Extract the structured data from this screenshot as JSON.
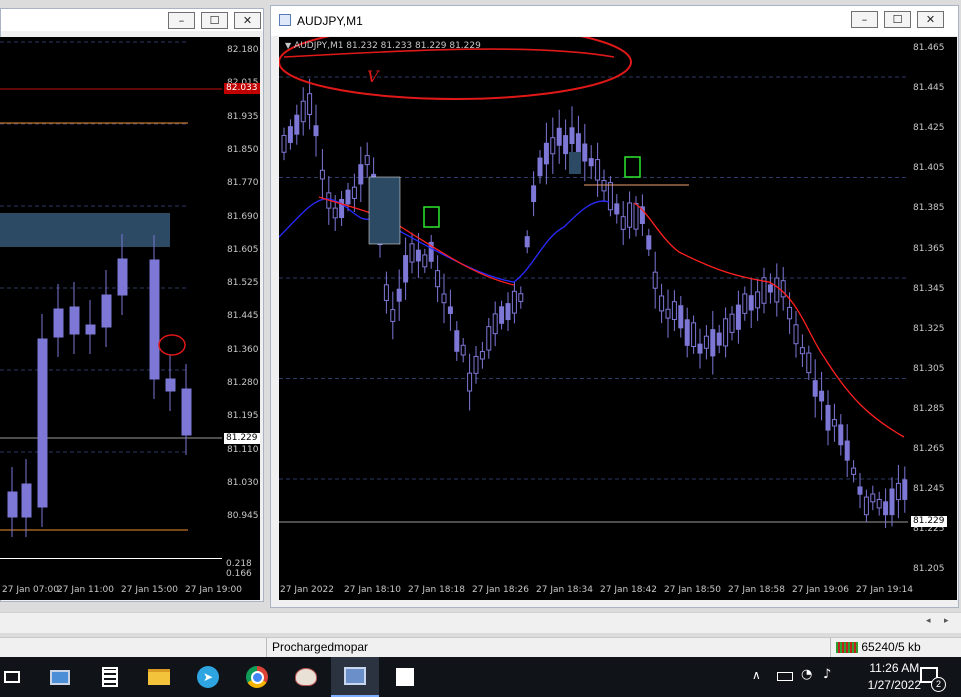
{
  "left_window": {
    "y_ticks": [
      "82.180",
      "82.015",
      "81.935",
      "81.850",
      "81.770",
      "81.690",
      "81.605",
      "81.525",
      "81.445",
      "81.360",
      "81.280",
      "81.195",
      "81.110",
      "81.030",
      "80.945"
    ],
    "red_tag": "82.033",
    "price_tag": "81.229",
    "indicator_ticks": [
      "0.218",
      "0.166"
    ],
    "x_ticks": [
      "27 Jan 07:00",
      "27 Jan 11:00",
      "27 Jan 15:00",
      "27 Jan 19:00"
    ]
  },
  "right_window": {
    "title": "AUDJPY,M1",
    "info_line": "AUDJPY,M1  81.232 81.233 81.229 81.229",
    "annotation_mark": "V",
    "y_ticks": [
      "81.465",
      "81.445",
      "81.425",
      "81.405",
      "81.385",
      "81.365",
      "81.345",
      "81.325",
      "81.305",
      "81.285",
      "81.265",
      "81.245",
      "81.225",
      "81.205"
    ],
    "price_tag": "81.229",
    "x_ticks": [
      "27 Jan 2022",
      "27 Jan 18:10",
      "27 Jan 18:18",
      "27 Jan 18:26",
      "27 Jan 18:34",
      "27 Jan 18:42",
      "27 Jan 18:50",
      "27 Jan 18:58",
      "27 Jan 19:06",
      "27 Jan 19:14"
    ],
    "minimize": "–",
    "maximize": "☐",
    "close": "✕"
  },
  "left_window_buttons": {
    "minimize": "–",
    "maximize": "☐",
    "close": "✕"
  },
  "status_bar": {
    "profile": "Prochargedmopar",
    "connection": "65240/5 kb"
  },
  "taskbar": {
    "time": "11:26 AM",
    "date": "1/27/2022",
    "notifications": "2",
    "apps": [
      "task-view",
      "computer",
      "calculator",
      "file-explorer",
      "telegram",
      "chrome",
      "paint",
      "metatrader",
      "sticky-notes"
    ]
  },
  "colors": {
    "chart_bg": "#000000",
    "candle": "#7d77d6",
    "ma_red": "#ff2020",
    "ma_blue": "#2a2aff",
    "grid": "#2b3a66",
    "zone": "#2c4a63"
  }
}
